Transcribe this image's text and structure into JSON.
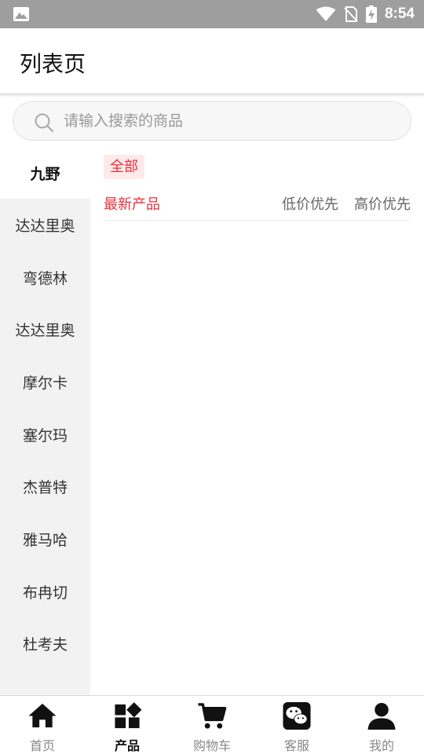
{
  "status": {
    "time": "8:54"
  },
  "header": {
    "title": "列表页"
  },
  "search": {
    "placeholder": "请输入搜索的商品"
  },
  "sidebar": {
    "items": [
      {
        "label": "九野",
        "active": true
      },
      {
        "label": "达达里奥"
      },
      {
        "label": "弯德林"
      },
      {
        "label": "达达里奥"
      },
      {
        "label": "摩尔卡"
      },
      {
        "label": "塞尔玛"
      },
      {
        "label": "杰普特"
      },
      {
        "label": "雅马哈"
      },
      {
        "label": "布冉切"
      },
      {
        "label": "杜考夫"
      }
    ]
  },
  "content": {
    "tag": "全部",
    "sort": {
      "newest": "最新产品",
      "low": "低价优先",
      "high": "高价优先"
    }
  },
  "tabbar": {
    "items": [
      {
        "label": "首页",
        "icon": "home-icon"
      },
      {
        "label": "产品",
        "icon": "grid-icon",
        "active": true
      },
      {
        "label": "购物车",
        "icon": "cart-icon"
      },
      {
        "label": "客服",
        "icon": "wechat-icon"
      },
      {
        "label": "我的",
        "icon": "user-icon"
      }
    ]
  },
  "colors": {
    "accent": "#e8313b",
    "statusbar": "#9e9e9e"
  }
}
